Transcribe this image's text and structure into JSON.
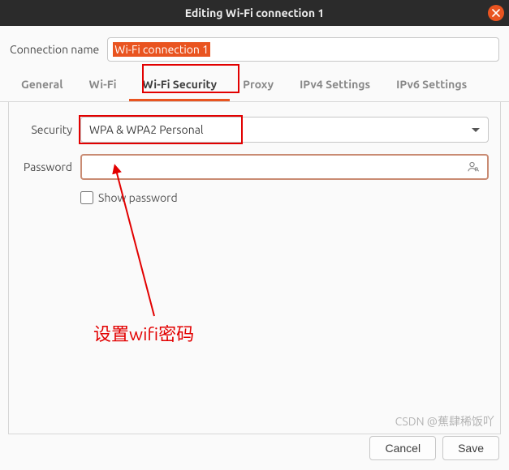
{
  "titlebar": {
    "title": "Editing Wi-Fi connection 1"
  },
  "connection": {
    "label": "Connection name",
    "value": "Wi-Fi connection 1"
  },
  "tabs": {
    "general": "General",
    "wifi": "Wi-Fi",
    "wifisec": "Wi-Fi Security",
    "proxy": "Proxy",
    "ipv4": "IPv4 Settings",
    "ipv6": "IPv6 Settings"
  },
  "form": {
    "security_label": "Security",
    "security_value": "WPA & WPA2 Personal",
    "password_label": "Password",
    "password_value": "",
    "show_password": "Show password"
  },
  "buttons": {
    "cancel": "Cancel",
    "save": "Save"
  },
  "annotation": {
    "text": "设置wifi密码"
  },
  "watermark": "CSDN @蕉肆稀饭吖"
}
